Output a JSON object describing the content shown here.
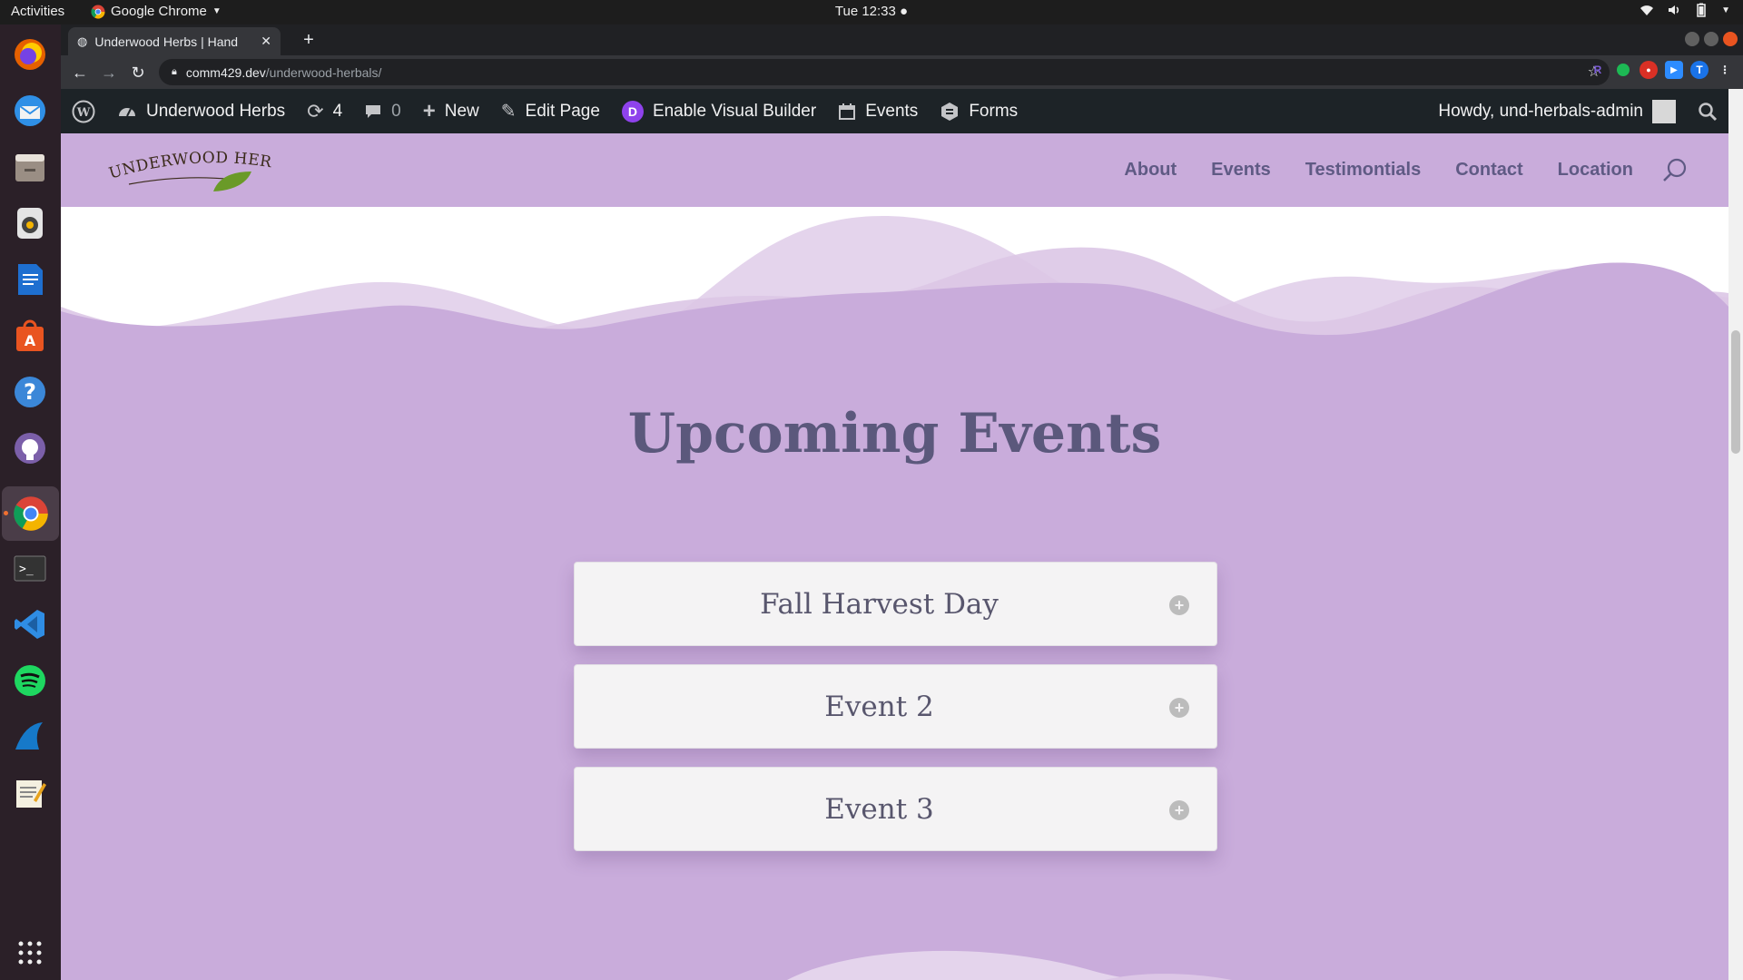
{
  "system": {
    "activities": "Activities",
    "app_name": "Google Chrome",
    "clock": "Tue 12:33"
  },
  "browser": {
    "tab_title": "Underwood Herbs | Hand",
    "url_host": "comm429.dev",
    "url_path": "/underwood-herbals/",
    "profile_initial": "T"
  },
  "admin_bar": {
    "site_name": "Underwood Herbs",
    "updates_count": "4",
    "comments_count": "0",
    "new_label": "New",
    "edit_label": "Edit Page",
    "divi_letter": "D",
    "visual_builder_label": "Enable Visual Builder",
    "events_label": "Events",
    "forms_label": "Forms",
    "howdy": "Howdy, und-herbals-admin"
  },
  "site": {
    "logo_text": "UNDERWOOD HERBS",
    "nav": [
      "About",
      "Events",
      "Testimontials",
      "Contact",
      "Location"
    ]
  },
  "section": {
    "heading": "Upcoming Events",
    "events": [
      "Fall Harvest Day",
      "Event 2",
      "Event 3"
    ]
  },
  "colors": {
    "page_bg": "#c9acdb",
    "heading": "#5b587c",
    "admin_bar": "#1d2327",
    "accent_divi": "#8f42ec"
  }
}
